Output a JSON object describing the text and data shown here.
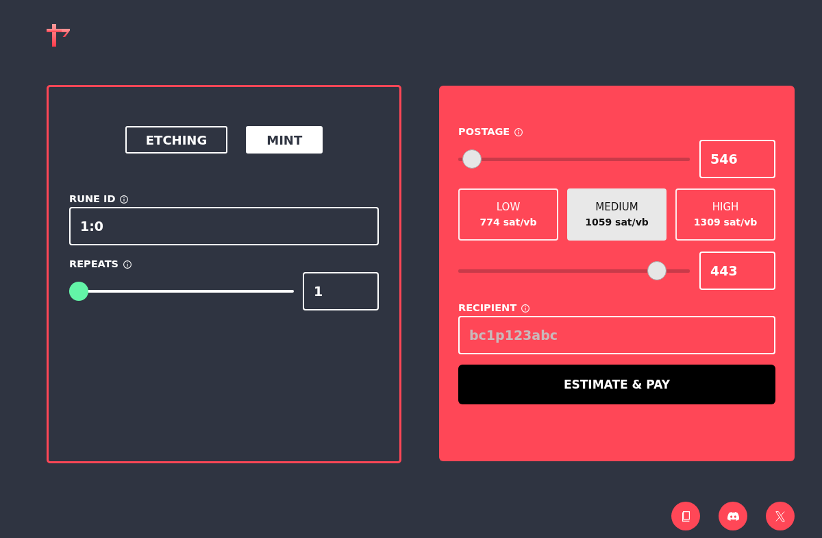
{
  "mode_tabs": [
    {
      "label": "ETCHING",
      "selected": false
    },
    {
      "label": "MINT",
      "selected": true
    }
  ],
  "mint_form": {
    "rune_id": {
      "label": "RUNE ID",
      "value": "1:0"
    },
    "repeats": {
      "label": "REPEATS",
      "level": 0,
      "value": "1"
    }
  },
  "payment": {
    "postage": {
      "label": "POSTAGE",
      "level": 0.02,
      "value": "546"
    },
    "fee_options": [
      {
        "label": "LOW",
        "rate": "774 sat/vb",
        "selected": false
      },
      {
        "label": "MEDIUM",
        "rate": "1059 sat/vb",
        "selected": true
      },
      {
        "label": "HIGH",
        "rate": "1309 sat/vb",
        "selected": false
      }
    ],
    "fee_rate": {
      "level": 0.89,
      "value": "443"
    },
    "recipient": {
      "label": "RECIPIENT",
      "placeholder": "bc1p123abc"
    },
    "submit_button": "ESTIMATE & PAY"
  }
}
